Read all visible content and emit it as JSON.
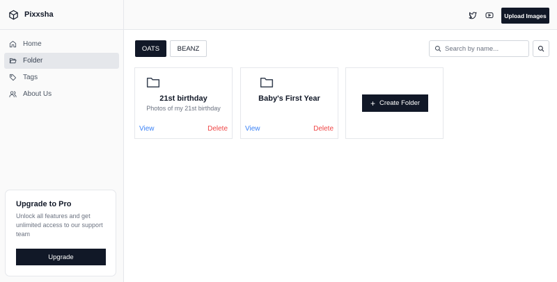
{
  "app": {
    "name": "Pixxsha",
    "logo_icon": "cube-icon"
  },
  "sidebar": {
    "items": [
      {
        "label": "Home",
        "icon": "home-icon",
        "active": false
      },
      {
        "label": "Folder",
        "icon": "folder-open-icon",
        "active": true
      },
      {
        "label": "Tags",
        "icon": "tag-icon",
        "active": false
      },
      {
        "label": "About Us",
        "icon": "users-icon",
        "active": false
      }
    ]
  },
  "promo": {
    "title": "Upgrade to Pro",
    "description": "Unlock all features and get unlimited access to our support team",
    "button_label": "Upgrade"
  },
  "header": {
    "icons": [
      "twitter-icon",
      "youtube-icon"
    ],
    "upload_label": "Upload Images"
  },
  "tabs": [
    {
      "label": "OATS",
      "active": true
    },
    {
      "label": "BEANZ",
      "active": false
    }
  ],
  "search": {
    "placeholder": "Search by name...",
    "value": ""
  },
  "folders": [
    {
      "title": "21st birthday",
      "subtitle": "Photos of my 21st birthday",
      "view_label": "View",
      "delete_label": "Delete"
    },
    {
      "title": "Baby's First Year",
      "subtitle": "",
      "view_label": "View",
      "delete_label": "Delete"
    }
  ],
  "create_folder": {
    "label": "Create Folder"
  },
  "colors": {
    "primary": "#111827",
    "sidebar_bg": "#fafafa",
    "active_item_bg": "#e5e7eb",
    "link": "#3b82f6",
    "danger": "#ef4444",
    "muted_text": "#6b7280"
  }
}
